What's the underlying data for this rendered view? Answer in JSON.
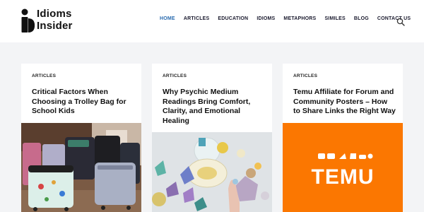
{
  "brand": {
    "line1": "Idioms",
    "line2": "Insider"
  },
  "nav": {
    "items": [
      "HOME",
      "ARTICLES",
      "EDUCATION",
      "IDIOMS",
      "METAPHORS",
      "SIMILES",
      "BLOG",
      "CONTACT US"
    ],
    "active": "HOME"
  },
  "search": {
    "icon": "search-icon"
  },
  "cards": [
    {
      "category": "ARTICLES",
      "title": "Critical Factors When Choosing a Trolley Bag for School Kids"
    },
    {
      "category": "ARTICLES",
      "title": "Why Psychic Medium Readings Bring Comfort, Clarity, and Emotional Healing"
    },
    {
      "category": "ARTICLES",
      "title": "Temu Affiliate for Forum and Community Posters – How to Share Links the Right Way",
      "image_logo_text": "TEMU"
    }
  ],
  "colors": {
    "accent": "#2b6cb0",
    "temu_orange": "#fb7701"
  }
}
